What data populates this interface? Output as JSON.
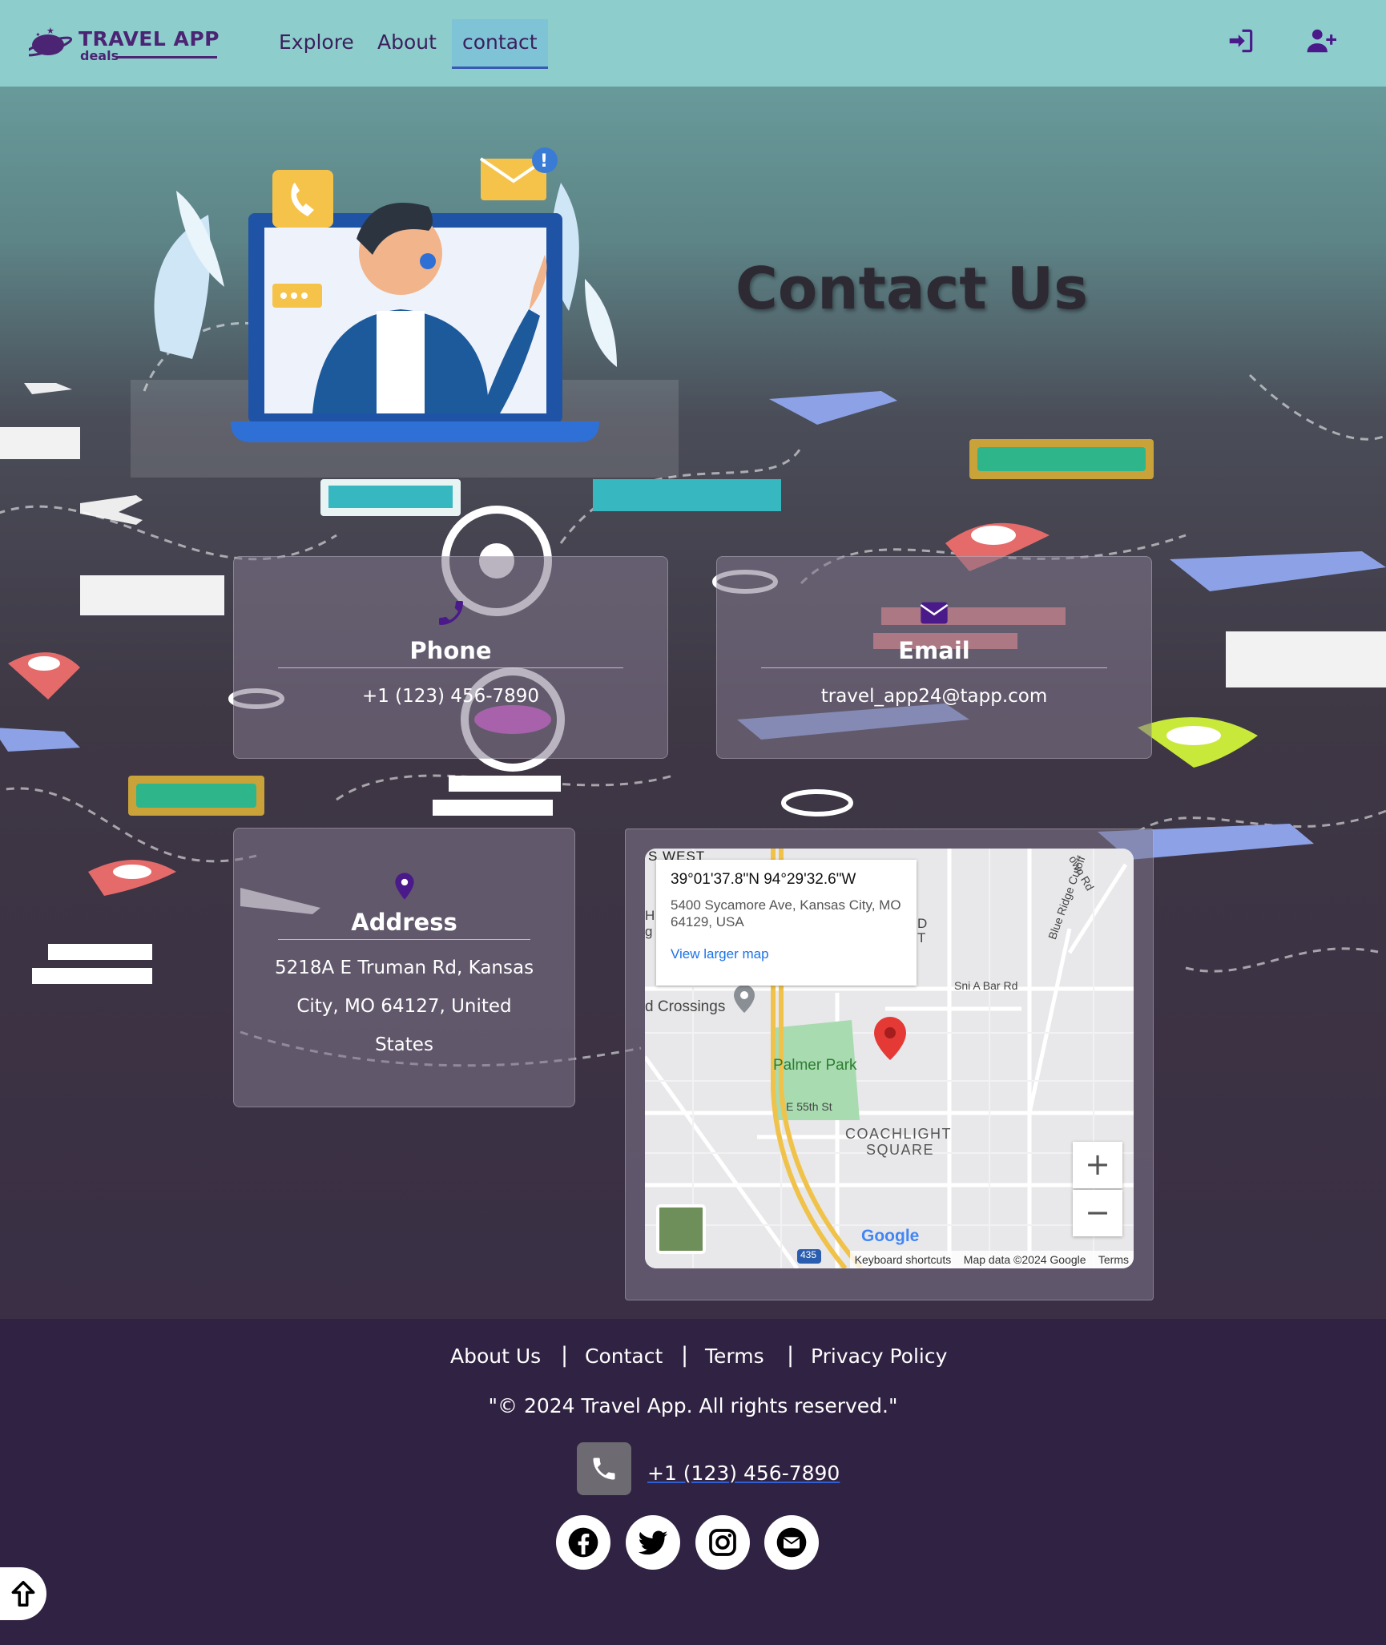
{
  "brand": {
    "name": "TRAVEL APP",
    "tagline": "deals"
  },
  "nav": {
    "items": [
      {
        "label": "Explore"
      },
      {
        "label": "About"
      },
      {
        "label": "contact"
      }
    ]
  },
  "hero": {
    "title": "Contact Us"
  },
  "cards": {
    "phone": {
      "title": "Phone",
      "value": "+1 (123) 456-7890"
    },
    "email": {
      "title": "Email",
      "value": "travel_app24@tapp.com"
    },
    "address": {
      "title": "Address",
      "value": "5218A E Truman Rd, Kansas City, MO 64127, United States"
    }
  },
  "map": {
    "coord": "39°01'37.8\"N 94°29'32.6\"W",
    "address": "5400 Sycamore Ave, Kansas City, MO 64129, USA",
    "larger_link": "View larger map",
    "labels": {
      "west": "S WEST",
      "crossings": "d Crossings",
      "park": "Palmer Park",
      "street55": "E 55th St",
      "square1": "COACHLIGHT",
      "square2": "SQUARE",
      "snia": "Sni A Bar Rd",
      "blueridge": "Blue Ridge Cutoff",
      "townrd": "own Rd",
      "d": "D",
      "t": "T",
      "h": "H",
      "g": "g",
      "highway": "435",
      "google": "Google"
    },
    "zoom_in": "+",
    "zoom_out": "−",
    "footer": {
      "shortcuts": "Keyboard shortcuts",
      "data": "Map data ©2024 Google",
      "terms": "Terms"
    }
  },
  "footer": {
    "links": [
      {
        "label": "About Us"
      },
      {
        "label": "Contact"
      },
      {
        "label": "Terms"
      },
      {
        "label": "Privacy Policy"
      }
    ],
    "separator": "|",
    "copyright": "\"© 2024 Travel App. All rights reserved.\"",
    "phone": "+1 (123) 456-7890"
  },
  "icons": [
    "login-icon",
    "user-plus-icon",
    "phone-icon",
    "envelope-icon",
    "map-pin-icon",
    "facebook-icon",
    "twitter-icon",
    "instagram-icon",
    "mail-icon",
    "arrow-up-icon"
  ],
  "colors": {
    "navbar": "#8dcecd",
    "nav_text": "#3b1f5c",
    "icon_purple": "#4b1a8a",
    "footer_bg": "#302242",
    "link_blue": "#1a73e8"
  }
}
